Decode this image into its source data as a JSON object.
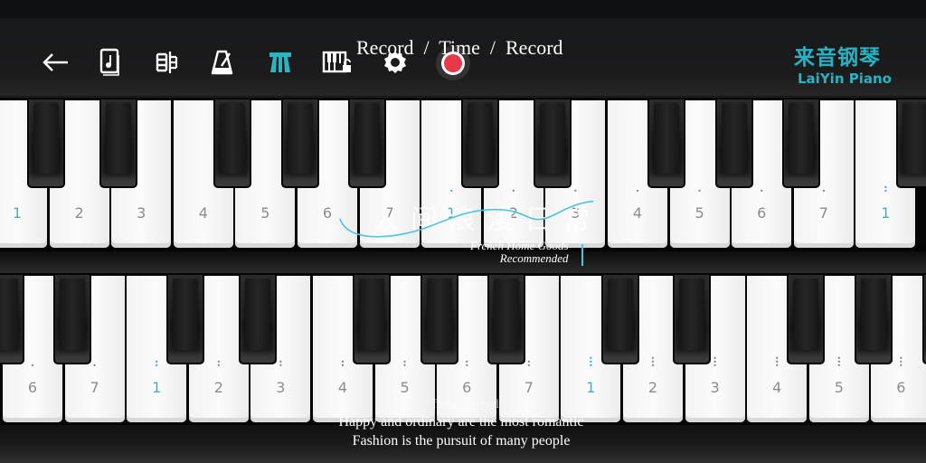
{
  "toolbar": {
    "record_title": "Record  /  Time  /  Record",
    "buttons": [
      {
        "icon": "back-arrow-icon"
      },
      {
        "icon": "songbook-icon"
      },
      {
        "icon": "sheet-music-icon"
      },
      {
        "icon": "metronome-icon"
      },
      {
        "icon": "pedal-icon",
        "active": true
      },
      {
        "icon": "keyboard-lock-icon"
      },
      {
        "icon": "gear-icon"
      },
      {
        "icon": "record-icon"
      }
    ],
    "accent_color": "#2bb5c3",
    "record_color": "#e8394a"
  },
  "logo": {
    "cn": "来音钢琴",
    "en": "LaiYin Piano"
  },
  "keyboard_top": {
    "keys": [
      {
        "label": "1",
        "dots": 0
      },
      {
        "label": "2",
        "dots": 0
      },
      {
        "label": "3",
        "dots": 0
      },
      {
        "label": "4",
        "dots": 0
      },
      {
        "label": "5",
        "dots": 0
      },
      {
        "label": "6",
        "dots": 0
      },
      {
        "label": "7",
        "dots": 0
      },
      {
        "label": "1",
        "dots": 1
      },
      {
        "label": "2",
        "dots": 1
      },
      {
        "label": "3",
        "dots": 1
      },
      {
        "label": "4",
        "dots": 1
      },
      {
        "label": "5",
        "dots": 1
      },
      {
        "label": "6",
        "dots": 1
      },
      {
        "label": "7",
        "dots": 1
      },
      {
        "label": "1",
        "dots": 2
      }
    ]
  },
  "keyboard_bottom": {
    "keys": [
      {
        "label": "6",
        "dots": 1
      },
      {
        "label": "7",
        "dots": 1
      },
      {
        "label": "1",
        "dots": 2
      },
      {
        "label": "2",
        "dots": 2
      },
      {
        "label": "3",
        "dots": 2
      },
      {
        "label": "4",
        "dots": 2
      },
      {
        "label": "5",
        "dots": 2
      },
      {
        "label": "6",
        "dots": 2
      },
      {
        "label": "7",
        "dots": 2
      },
      {
        "label": "1",
        "dots": 3
      },
      {
        "label": "2",
        "dots": 3
      },
      {
        "label": "3",
        "dots": 3
      },
      {
        "label": "4",
        "dots": 3
      },
      {
        "label": "5",
        "dots": 3
      },
      {
        "label": "6",
        "dots": 3
      }
    ]
  },
  "overlay": {
    "cn_slogan": "人间浪漫日常",
    "line1": "French Home Goods",
    "line2": "Recommended",
    "fashion_trend": "fashion trend",
    "bottom1": "Happy and ordinary are the most romantic",
    "bottom2": "Fashion is the pursuit of many people"
  }
}
